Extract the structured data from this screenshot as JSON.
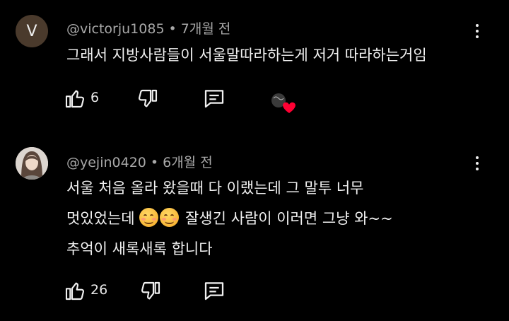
{
  "comments": [
    {
      "avatar_letter": "V",
      "author": "@victorju1085",
      "separator": "•",
      "time": "7개월 전",
      "lines": [
        "그래서 지방사람들이 서울말따라하는게 저거 따라하는거임"
      ],
      "likes": "6",
      "creator_heart": true
    },
    {
      "avatar_letter": "",
      "author": "@yejin0420",
      "separator": "•",
      "time": "6개월 전",
      "line1": "서울 처음 올라 왔을때 다 이랬는데 그 말투 너무",
      "line2_before": "멋있었는데 ",
      "line2_after": " 잘생긴 사람이 이러면 그냥 와~~",
      "line3": "추억이 새록새록 합니다",
      "likes": "26"
    }
  ],
  "colors": {
    "background": "#000000",
    "text": "#f1f1f1",
    "meta": "#a8a8a8",
    "heart": "#ff0033"
  },
  "icons": [
    "like-icon",
    "dislike-icon",
    "reply-icon",
    "more-icon",
    "creator-heart-icon",
    "smiling-face-emoji"
  ]
}
